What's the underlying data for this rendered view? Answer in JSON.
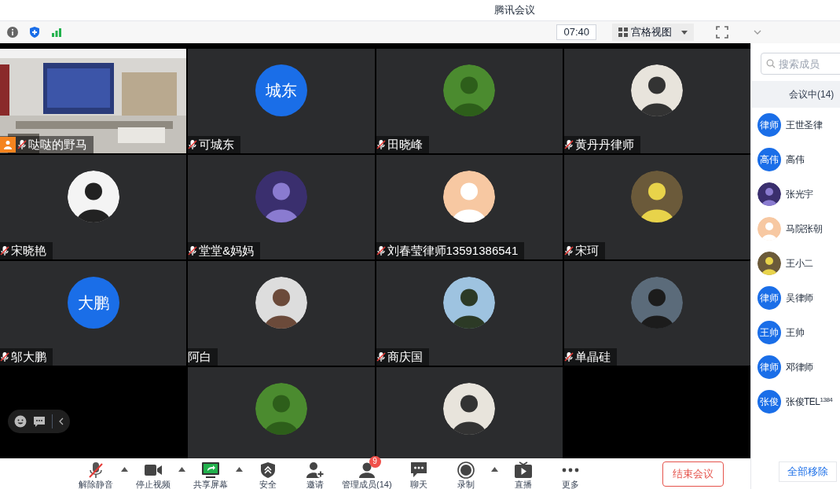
{
  "window": {
    "title": "腾讯会议"
  },
  "topbar": {
    "timer": "07:40",
    "view_label": "宫格视图"
  },
  "tiles": [
    {
      "kind": "video",
      "name": "哒哒的野马",
      "muted": true,
      "host": true
    },
    {
      "kind": "text_avatar",
      "avatar_text": "城东",
      "name": "可城东",
      "muted": true,
      "host": false
    },
    {
      "kind": "image_avatar",
      "name": "田晓峰",
      "muted": true,
      "host": false
    },
    {
      "kind": "image_avatar",
      "name": "黄丹丹律师",
      "muted": true,
      "host": false
    },
    {
      "kind": "image_avatar",
      "name": "宋晓艳",
      "muted": true,
      "host": false
    },
    {
      "kind": "image_avatar",
      "name": "堂堂&妈妈",
      "muted": true,
      "host": false
    },
    {
      "kind": "image_avatar",
      "name": "刘春莹律师13591386541",
      "muted": true,
      "host": false
    },
    {
      "kind": "image_avatar",
      "name": "宋珂",
      "muted": true,
      "host": false
    },
    {
      "kind": "text_avatar",
      "avatar_text": "大鹏",
      "name": "邬大鹏",
      "muted": true,
      "host": false
    },
    {
      "kind": "image_avatar",
      "name": "阿白",
      "muted": false,
      "host": false
    },
    {
      "kind": "image_avatar",
      "name": "商庆国",
      "muted": true,
      "host": false
    },
    {
      "kind": "image_avatar",
      "name": "单晶硅",
      "muted": true,
      "host": false
    },
    {
      "kind": "empty"
    },
    {
      "kind": "image_avatar"
    },
    {
      "kind": "image_avatar"
    },
    {
      "kind": "empty"
    }
  ],
  "toolbar": [
    {
      "kind": "mic",
      "label": "解除静音",
      "caret": true
    },
    {
      "kind": "camera",
      "label": "停止视频",
      "caret": true
    },
    {
      "kind": "share",
      "label": "共享屏幕",
      "caret": true
    },
    {
      "kind": "security",
      "label": "安全",
      "caret": false
    },
    {
      "kind": "invite",
      "label": "邀请",
      "caret": false
    },
    {
      "kind": "members",
      "label": "管理成员(14)",
      "caret": false,
      "badge": "9"
    },
    {
      "kind": "chat",
      "label": "聊天",
      "caret": false
    },
    {
      "kind": "record",
      "label": "录制",
      "caret": true
    },
    {
      "kind": "live",
      "label": "直播",
      "caret": false
    },
    {
      "kind": "more",
      "label": "更多",
      "caret": false
    }
  ],
  "end_button": "结束会议",
  "sidebar": {
    "search": {
      "placeholder": "搜索成员"
    },
    "header": "会议中(14)",
    "members": [
      {
        "kind": "text",
        "avatar_text": "律师",
        "name": "王世圣律"
      },
      {
        "kind": "text",
        "avatar_text": "高伟",
        "name": "高伟"
      },
      {
        "name": "张光宇"
      },
      {
        "name": "马院张朝"
      },
      {
        "name": "王小二"
      },
      {
        "kind": "text",
        "avatar_text": "律师",
        "name": "吴律师"
      },
      {
        "kind": "text",
        "avatar_text": "王帅",
        "name": "王帅"
      },
      {
        "kind": "text",
        "avatar_text": "律师",
        "name": "邓律师"
      },
      {
        "kind": "text",
        "avatar_text": "张俊",
        "name": "张俊TEL$^{1384}$"
      }
    ],
    "remove_all_button": "全部移除"
  }
}
